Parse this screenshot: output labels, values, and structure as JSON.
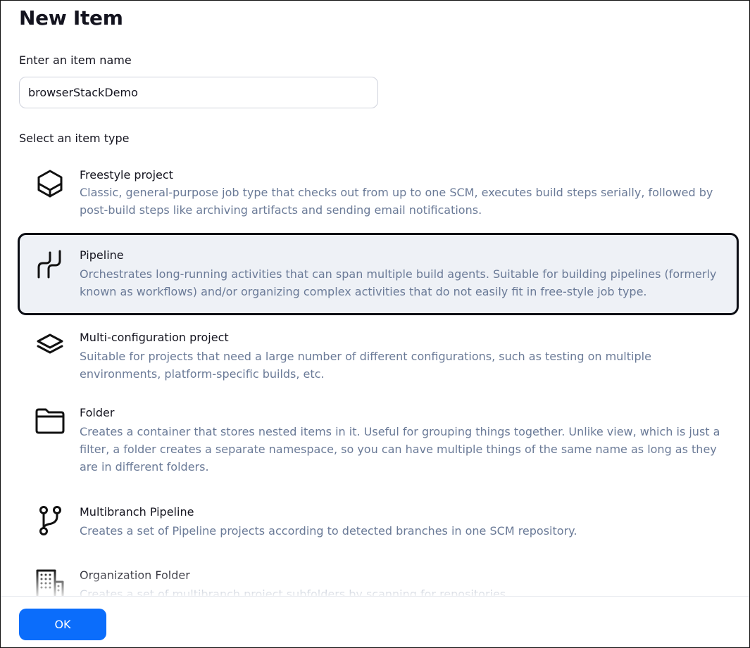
{
  "page": {
    "title": "New Item"
  },
  "name_field": {
    "label": "Enter an item name",
    "value": "browserStackDemo"
  },
  "type_section": {
    "label": "Select an item type"
  },
  "item_types": [
    {
      "icon": "cube-icon",
      "title": "Freestyle project",
      "description": "Classic, general-purpose job type that checks out from up to one SCM, executes build steps serially, followed by post-build steps like archiving artifacts and sending email notifications.",
      "selected": false
    },
    {
      "icon": "pipeline-icon",
      "title": "Pipeline",
      "description": "Orchestrates long-running activities that can span multiple build agents. Suitable for building pipelines (formerly known as workflows) and/or organizing complex activities that do not easily fit in free-style job type.",
      "selected": true
    },
    {
      "icon": "layers-icon",
      "title": "Multi-configuration project",
      "description": "Suitable for projects that need a large number of different configurations, such as testing on multiple environments, platform-specific builds, etc.",
      "selected": false
    },
    {
      "icon": "folder-icon",
      "title": "Folder",
      "description": "Creates a container that stores nested items in it. Useful for grouping things together. Unlike view, which is just a filter, a folder creates a separate namespace, so you can have multiple things of the same name as long as they are in different folders.",
      "selected": false
    },
    {
      "icon": "branch-icon",
      "title": "Multibranch Pipeline",
      "description": "Creates a set of Pipeline projects according to detected branches in one SCM repository.",
      "selected": false
    },
    {
      "icon": "building-icon",
      "title": "Organization Folder",
      "description": "Creates a set of multibranch project subfolders by scanning for repositories.",
      "selected": false
    }
  ],
  "footer": {
    "ok_label": "OK"
  },
  "colors": {
    "accent": "#0b6dfb",
    "selected_bg": "#eef1f6",
    "description": "#6a7a97"
  }
}
